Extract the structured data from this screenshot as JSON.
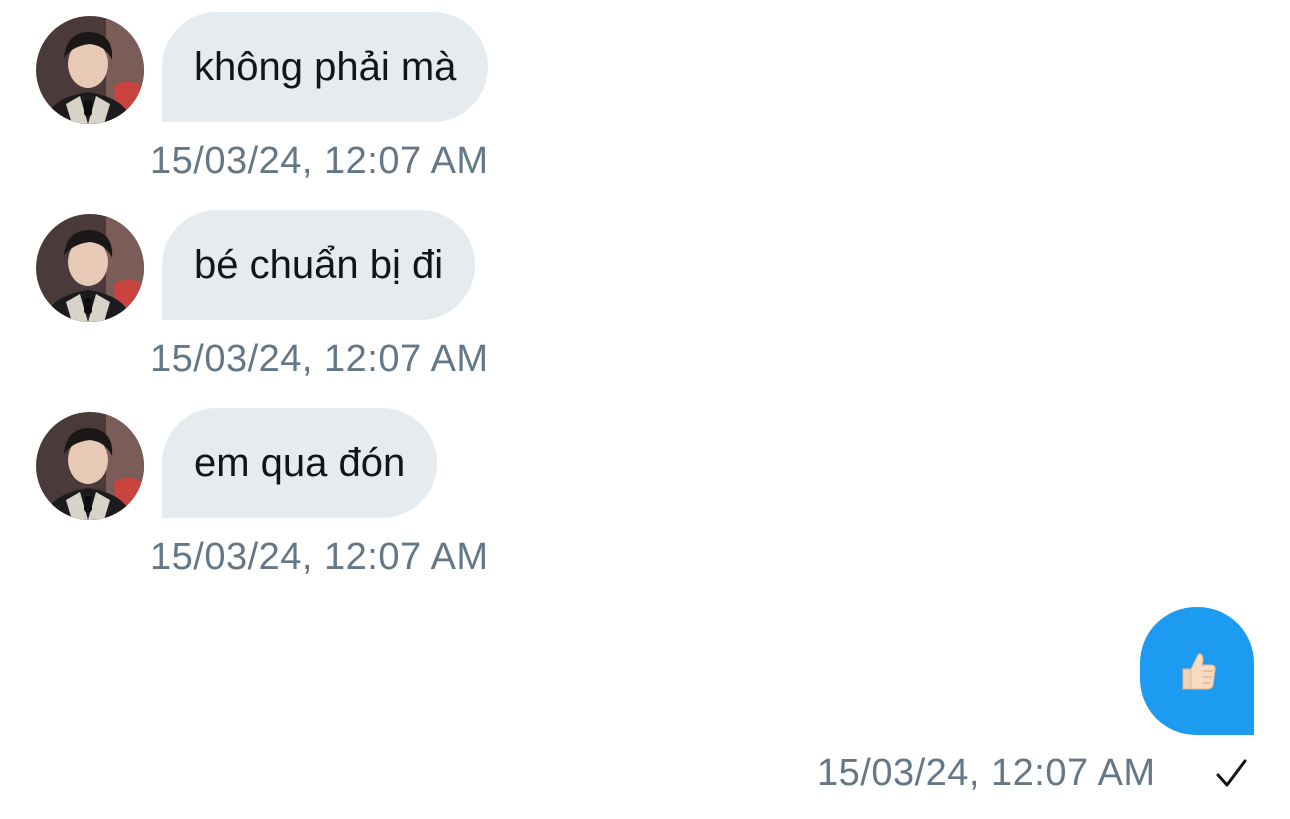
{
  "conversation": {
    "incoming": [
      {
        "text": "không phải mà",
        "timestamp": "15/03/24, 12:07 AM"
      },
      {
        "text": "bé chuẩn bị đi",
        "timestamp": "15/03/24, 12:07 AM"
      },
      {
        "text": "em qua đón",
        "timestamp": "15/03/24, 12:07 AM"
      }
    ],
    "outgoing": {
      "emoji": "thumbs-up-emoji",
      "timestamp": "15/03/24, 12:07 AM",
      "status_icon": "check-icon"
    }
  },
  "colors": {
    "incoming_bubble": "#e6ebef",
    "outgoing_bubble": "#1d9bf0",
    "timestamp_text": "#647786",
    "message_text": "#111418"
  }
}
